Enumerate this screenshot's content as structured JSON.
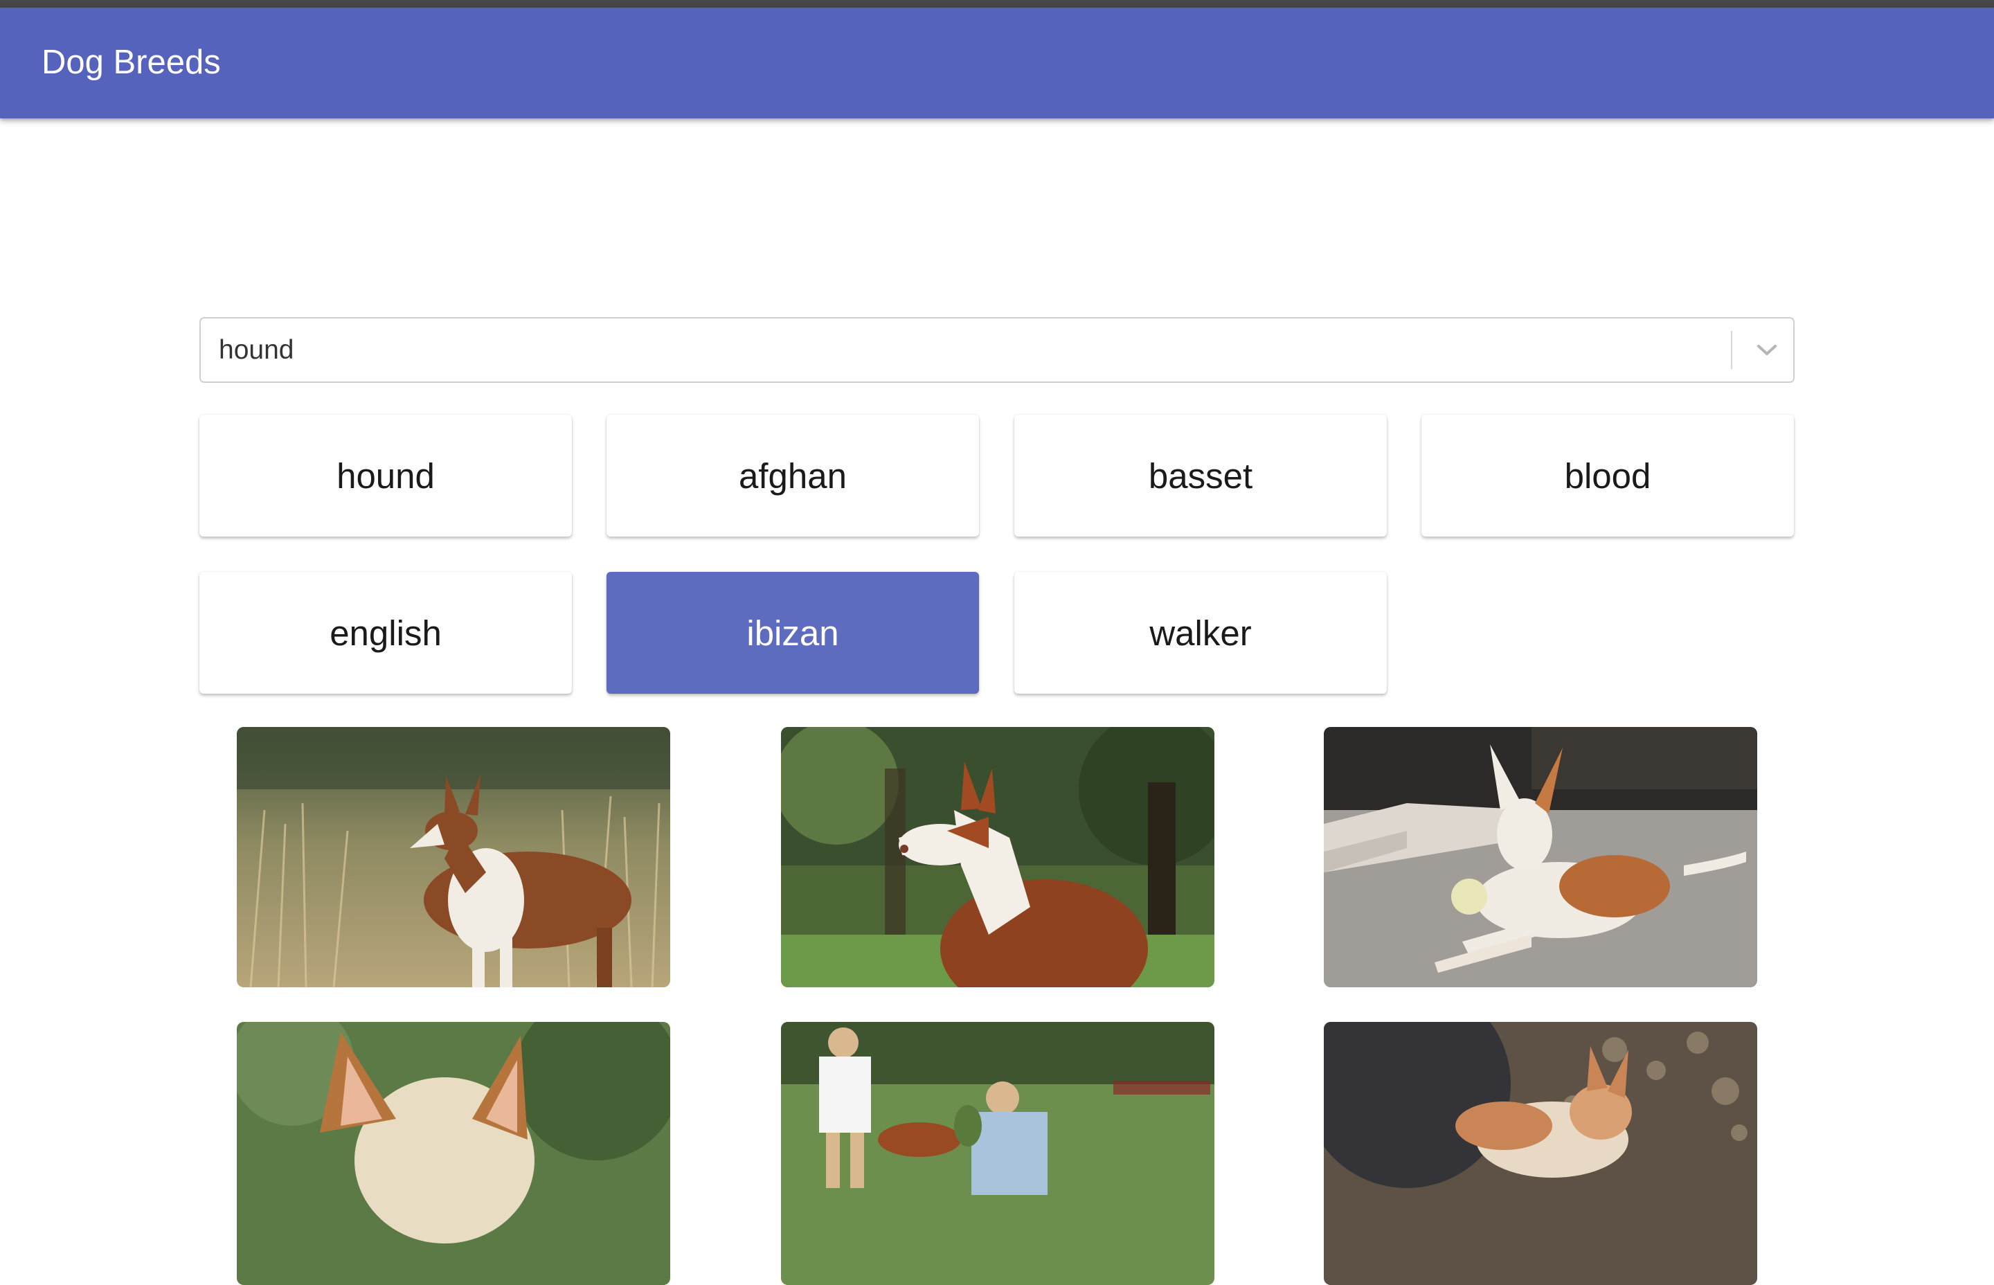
{
  "app": {
    "title": "Dog Breeds"
  },
  "breed_select": {
    "value": "hound",
    "icon": "chevron-down-icon"
  },
  "sub_breeds": [
    {
      "label": "hound",
      "active": false
    },
    {
      "label": "afghan",
      "active": false
    },
    {
      "label": "basset",
      "active": false
    },
    {
      "label": "blood",
      "active": false
    },
    {
      "label": "english",
      "active": false
    },
    {
      "label": "ibizan",
      "active": true
    },
    {
      "label": "walker",
      "active": false
    }
  ],
  "colors": {
    "app_bar": "#5563bc",
    "active_chip": "#5e6cc0",
    "top_strip": "#464646"
  }
}
